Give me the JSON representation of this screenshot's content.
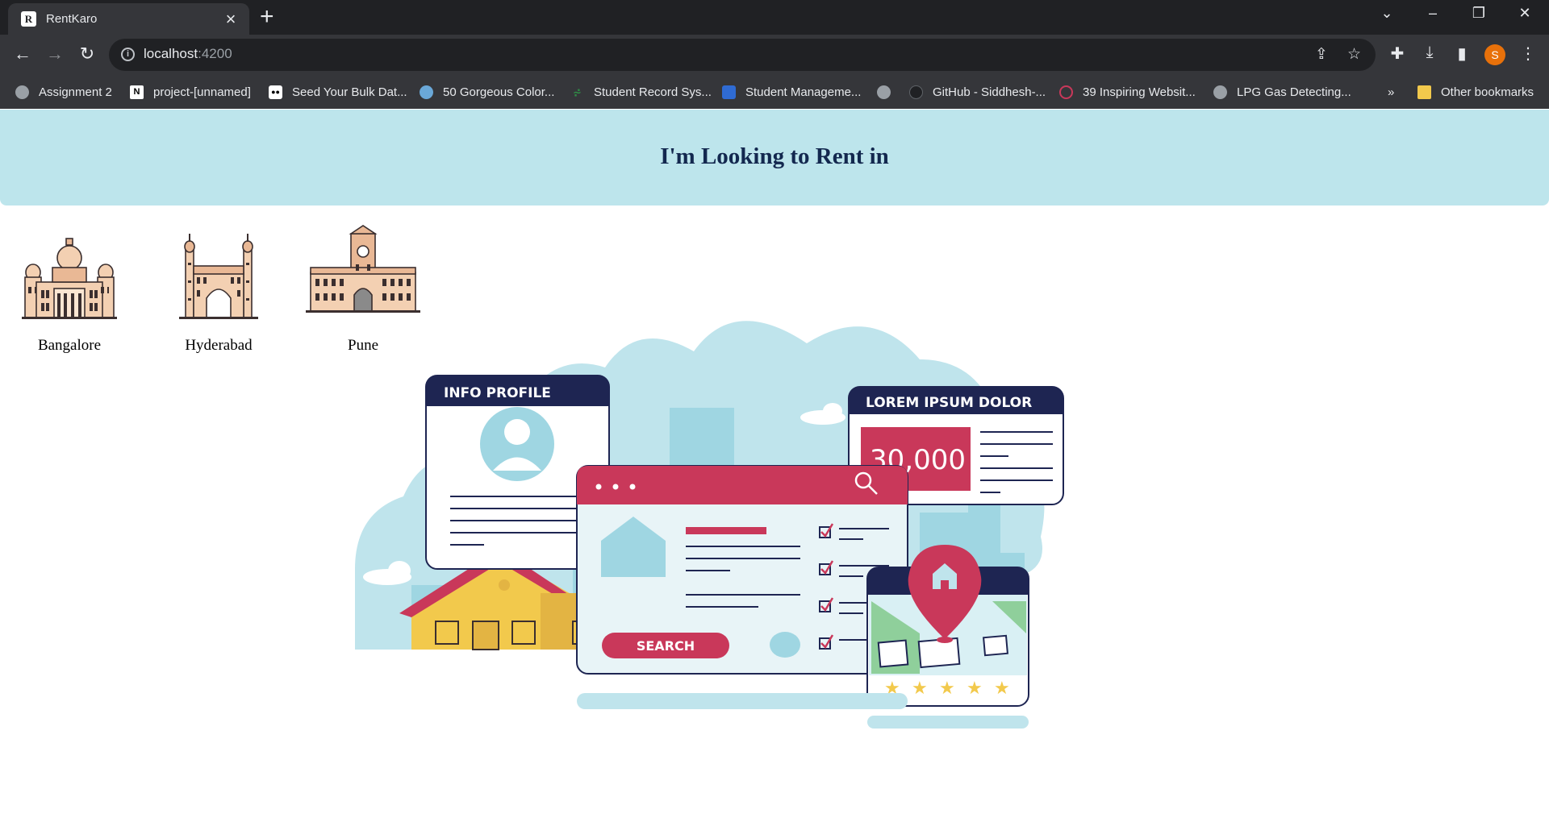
{
  "browser": {
    "tab_title": "RentKaro",
    "tab_favicon": "R",
    "url_host": "localhost",
    "url_port": ":4200",
    "profile_initial": "S",
    "bookmarks": [
      {
        "label": "Assignment 2",
        "icon": "globe-icon"
      },
      {
        "label": "project-[unnamed]",
        "icon": "notion-icon"
      },
      {
        "label": "Seed Your Bulk Dat...",
        "icon": "medium-icon"
      },
      {
        "label": "50 Gorgeous Color...",
        "icon": "palette-icon"
      },
      {
        "label": "Student Record Sys...",
        "icon": "gfg-icon"
      },
      {
        "label": "Student Manageme...",
        "icon": "grid-icon"
      },
      {
        "label": "",
        "icon": "globe-icon"
      },
      {
        "label": "GitHub - Siddhesh-...",
        "icon": "github-icon"
      },
      {
        "label": "39 Inspiring Websit...",
        "icon": "site-icon"
      },
      {
        "label": "LPG Gas Detecting...",
        "icon": "globe-icon"
      }
    ],
    "bookmarks_overflow": "»",
    "other_bookmarks": "Other bookmarks"
  },
  "page": {
    "heading": "I'm Looking to Rent in",
    "cities": [
      {
        "name": "Bangalore",
        "icon": "vidhana-soudha-icon"
      },
      {
        "name": "Hyderabad",
        "icon": "charminar-icon"
      },
      {
        "name": "Pune",
        "icon": "clock-tower-icon"
      }
    ],
    "illustration": {
      "info_card_title": "INFO PROFILE",
      "price_card_title": "LOREM IPSUM DOLOR",
      "price": "30,000 $",
      "search_button": "SEARCH",
      "rating_stars": 5
    }
  },
  "colors": {
    "hero_bg": "#bde5ec",
    "heading": "#13284f",
    "accent_red": "#c9385a",
    "navy": "#1e2552",
    "light_blue": "#bfe4ec"
  }
}
